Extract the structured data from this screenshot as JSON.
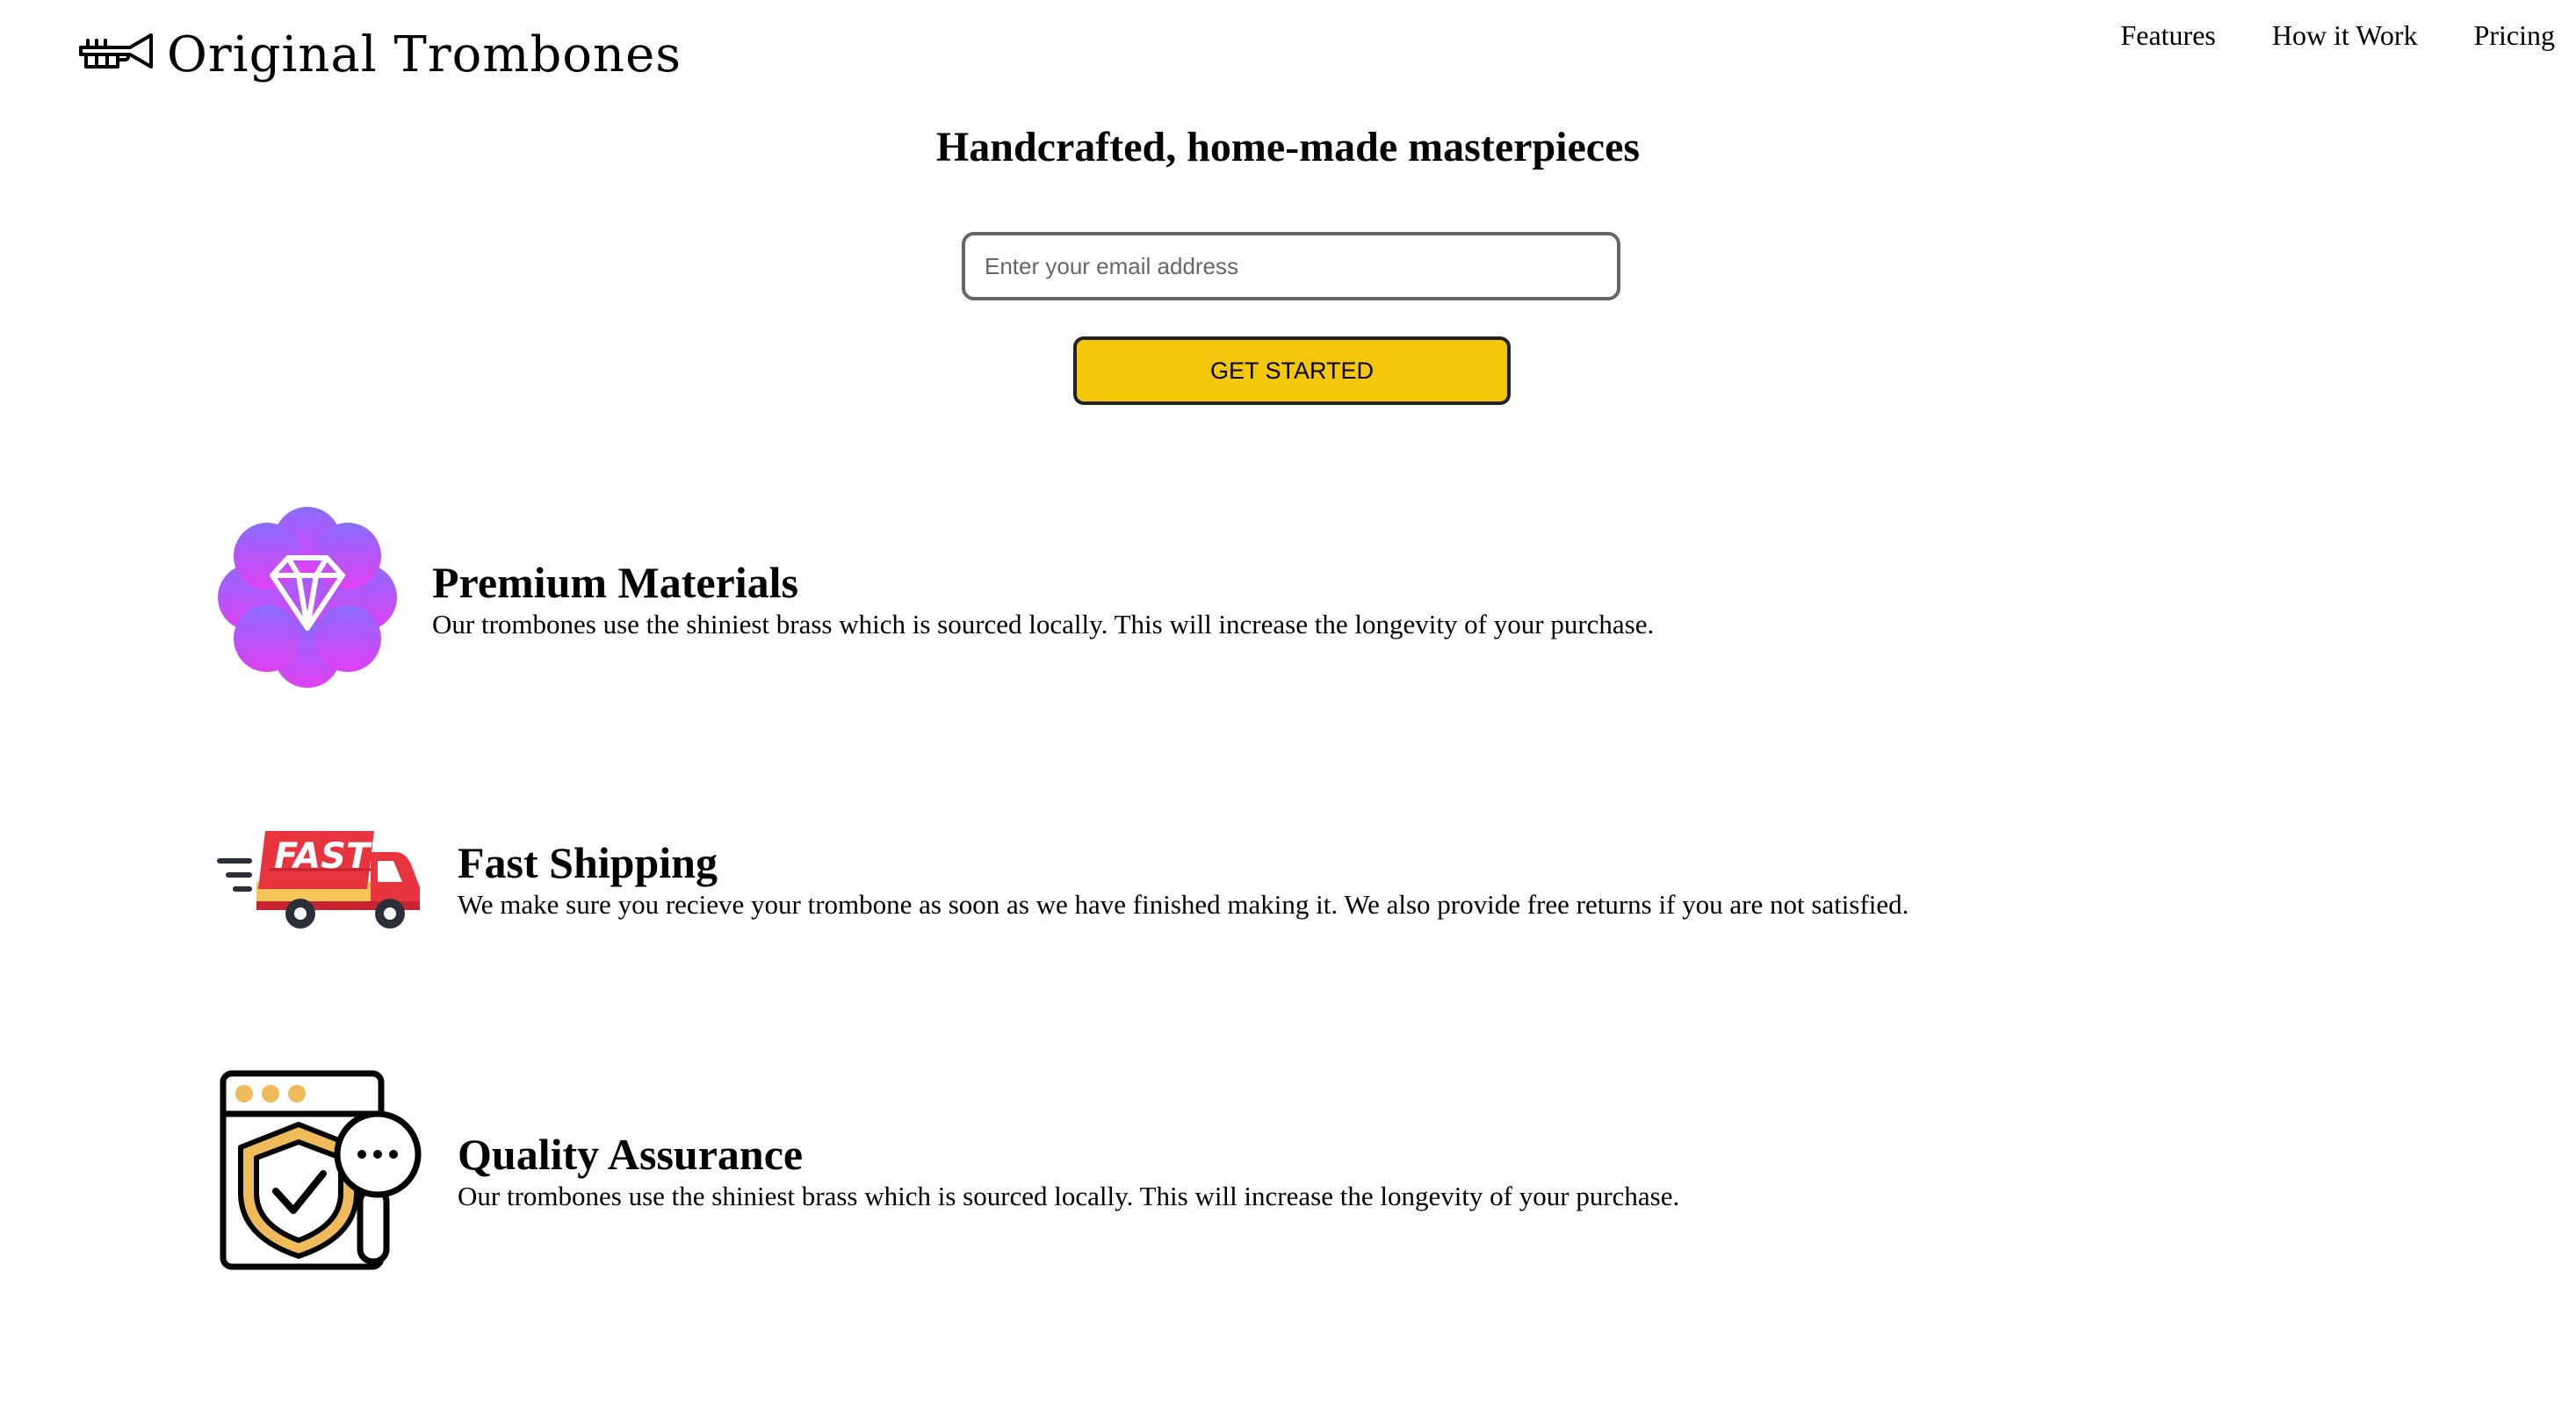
{
  "brand": {
    "logo_icon": "trombone-icon",
    "name": "Original Trombones"
  },
  "nav": {
    "items": [
      {
        "label": "Features"
      },
      {
        "label": "How it Work"
      },
      {
        "label": "Pricing"
      }
    ]
  },
  "hero": {
    "title": "Handcrafted, home-made masterpieces",
    "email_placeholder": "Enter your email address",
    "email_value": "",
    "cta_label": "GET STARTED",
    "cta_color": "#f5c70b"
  },
  "features": [
    {
      "icon": "diamond-badge-icon",
      "title": "Premium Materials",
      "description": "Our trombones use the shiniest brass which is sourced locally. This will increase the longevity of your purchase."
    },
    {
      "icon": "fast-truck-icon",
      "title": "Fast Shipping",
      "description": "We make sure you recieve your trombone as soon as we have finished making it. We also provide free returns if you are not satisfied."
    },
    {
      "icon": "quality-shield-icon",
      "title": "Quality Assurance",
      "description": "Our trombones use the shiniest brass which is sourced locally. This will increase the longevity of your purchase."
    }
  ],
  "colors": {
    "badge_gradient_top": "#8a6cff",
    "badge_gradient_bottom": "#e040f0",
    "truck_red": "#e8343f",
    "truck_yellow": "#f7c65a",
    "shield_gold": "#efbb5a"
  }
}
